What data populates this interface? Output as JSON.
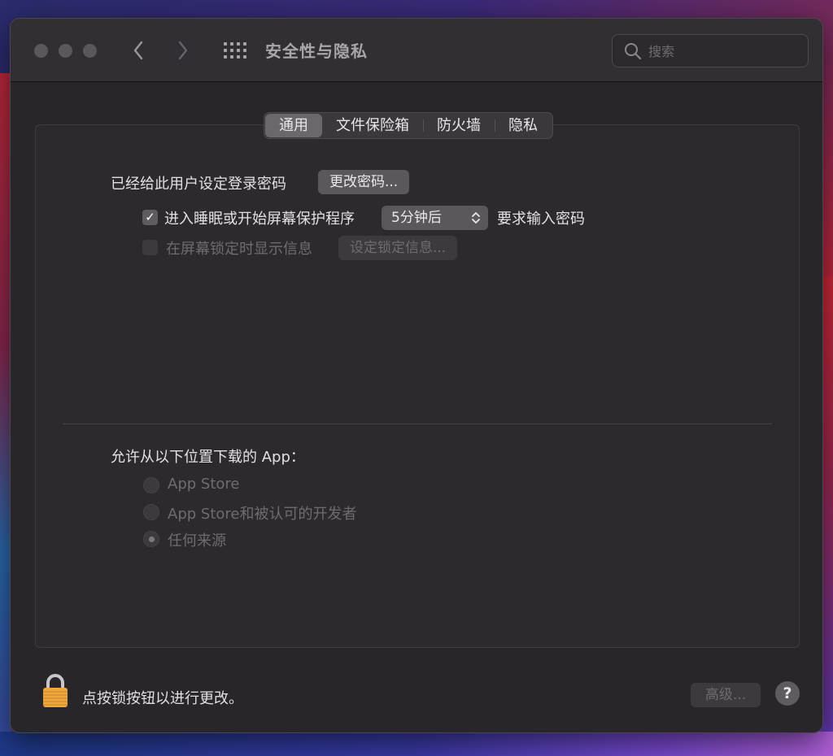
{
  "window": {
    "title": "安全性与隐私"
  },
  "nav": {
    "back_glyph": "‹",
    "forward_glyph": "›"
  },
  "search": {
    "placeholder": "搜索",
    "value": ""
  },
  "tabs": [
    {
      "label": "通用",
      "selected": true
    },
    {
      "label": "文件保险箱",
      "selected": false
    },
    {
      "label": "防火墙",
      "selected": false
    },
    {
      "label": "隐私",
      "selected": false
    }
  ],
  "general": {
    "password_set_label": "已经给此用户设定登录密码",
    "change_password_button": "更改密码...",
    "require_password": {
      "checked": true,
      "check_glyph": "✓",
      "label": "进入睡眠或开始屏幕保护程序",
      "delay_value": "5分钟后",
      "suffix": "要求输入密码"
    },
    "lock_message": {
      "checked": false,
      "enabled": false,
      "label": "在屏幕锁定时显示信息",
      "button": "设定锁定信息..."
    }
  },
  "downloads": {
    "heading": "允许从以下位置下载的 App：",
    "options": [
      {
        "label": "App Store",
        "selected": false
      },
      {
        "label": "App Store和被认可的开发者",
        "selected": false
      },
      {
        "label": "任何来源",
        "selected": true
      }
    ]
  },
  "footer": {
    "lock_text": "点按锁按钮以进行更改。",
    "advanced_button": "高级...",
    "help_glyph": "?"
  },
  "colors": {
    "window_bg": "#28262a",
    "selected_tab": "#6a686c",
    "lock_gold": "#f0a83c"
  }
}
